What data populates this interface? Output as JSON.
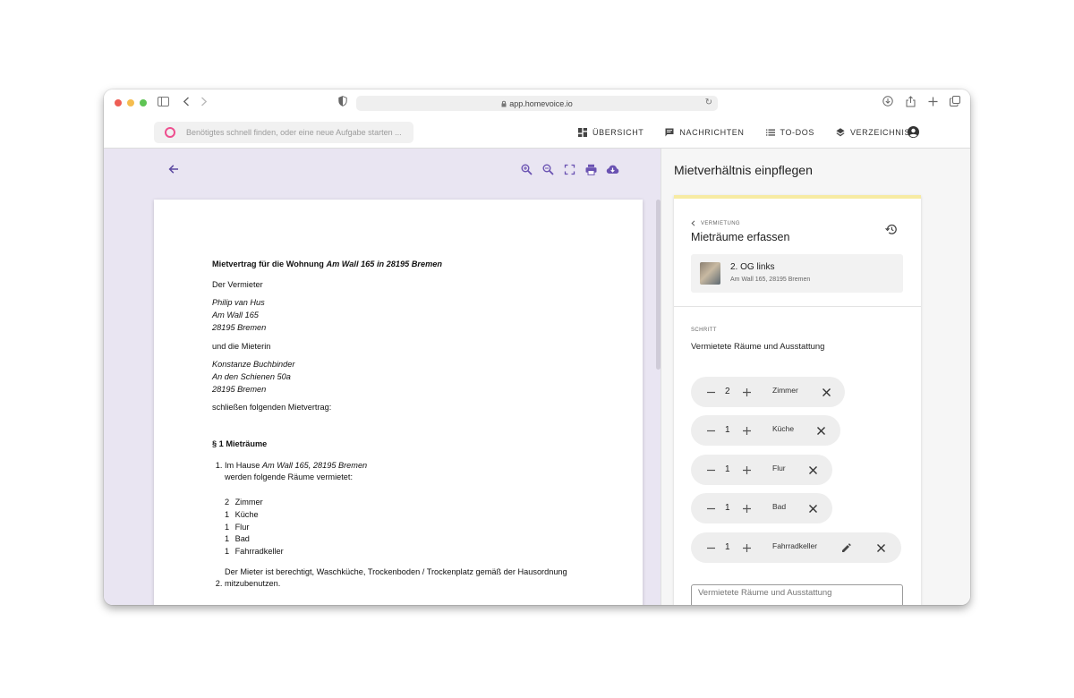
{
  "browser": {
    "url": "app.homevoice.io"
  },
  "header": {
    "search_placeholder": "Benötigtes schnell finden, oder eine neue Aufgabe starten ...",
    "nav": [
      {
        "label": "ÜBERSICHT",
        "icon": "dashboard-icon"
      },
      {
        "label": "NACHRICHTEN",
        "icon": "message-icon"
      },
      {
        "label": "TO-DOS",
        "icon": "list-icon"
      },
      {
        "label": "VERZEICHNIS",
        "icon": "layers-icon"
      }
    ]
  },
  "document": {
    "title_prefix": "Mietvertrag für die Wohnung ",
    "title_address": "Am Wall 165 in 28195 Bremen",
    "landlord_intro": "Der Vermieter",
    "landlord": [
      "Philip van Hus",
      "Am Wall 165",
      "28195 Bremen"
    ],
    "tenant_intro": "und die Mieterin",
    "tenant": [
      "Konstanze Buchbinder",
      "An den Schienen 50a",
      "28195 Bremen"
    ],
    "closing": "schließen folgenden Mietvertrag:",
    "section_title": "§ 1 Mieträume",
    "item1_prefix": "Im Hause ",
    "item1_address": "Am Wall 165, 28195 Bremen",
    "item1_suffix": "werden folgende Räume vermietet:",
    "rooms": [
      {
        "count": "2",
        "name": "Zimmer"
      },
      {
        "count": "1",
        "name": "Küche"
      },
      {
        "count": "1",
        "name": "Flur"
      },
      {
        "count": "1",
        "name": "Bad"
      },
      {
        "count": "1",
        "name": "Fahrradkeller"
      }
    ],
    "item2": "Der Mieter ist berechtigt, Waschküche, Trockenboden / Trockenplatz gemäß der Hausordnung mitzubenutzen."
  },
  "panel": {
    "title": "Mietverhältnis einpflegen",
    "breadcrumb": "VERMIETUNG",
    "card_title": "Mieträume erfassen",
    "unit_name": "2. OG links",
    "unit_address": "Am Wall 165, 28195 Bremen",
    "step_label": "SCHRITT",
    "step_text": "Vermietete Räume und Ausstattung",
    "chips": [
      {
        "qty": "2",
        "label": "Zimmer"
      },
      {
        "qty": "1",
        "label": "Küche"
      },
      {
        "qty": "1",
        "label": "Flur"
      },
      {
        "qty": "1",
        "label": "Bad"
      },
      {
        "qty": "1",
        "label": "Fahrradkeller"
      }
    ],
    "textfield_placeholder": "Vermietete Räume und Ausstattung"
  },
  "colors": {
    "accent": "#6a52b2",
    "doc_background": "#e9e5f2",
    "card_highlight": "#f7eba3",
    "search_ring": "#ee4f8f"
  }
}
